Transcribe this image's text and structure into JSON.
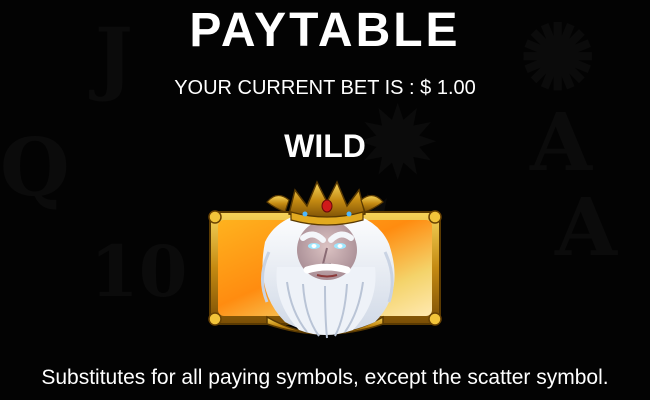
{
  "paytable": {
    "title": "PAYTABLE",
    "bet_prefix": "YOUR CURRENT BET IS : $ ",
    "bet_amount": "1.00",
    "symbol": {
      "name": "WILD",
      "icon": "poseidon-wild-icon",
      "description": "Substitutes for all paying symbols, except the scatter symbol."
    }
  },
  "colors": {
    "background": "#050505",
    "text": "#ffffff",
    "frame_gold": "#d4a21a",
    "crown_gold": "#e8b522",
    "jewel_red": "#d01a1a"
  }
}
